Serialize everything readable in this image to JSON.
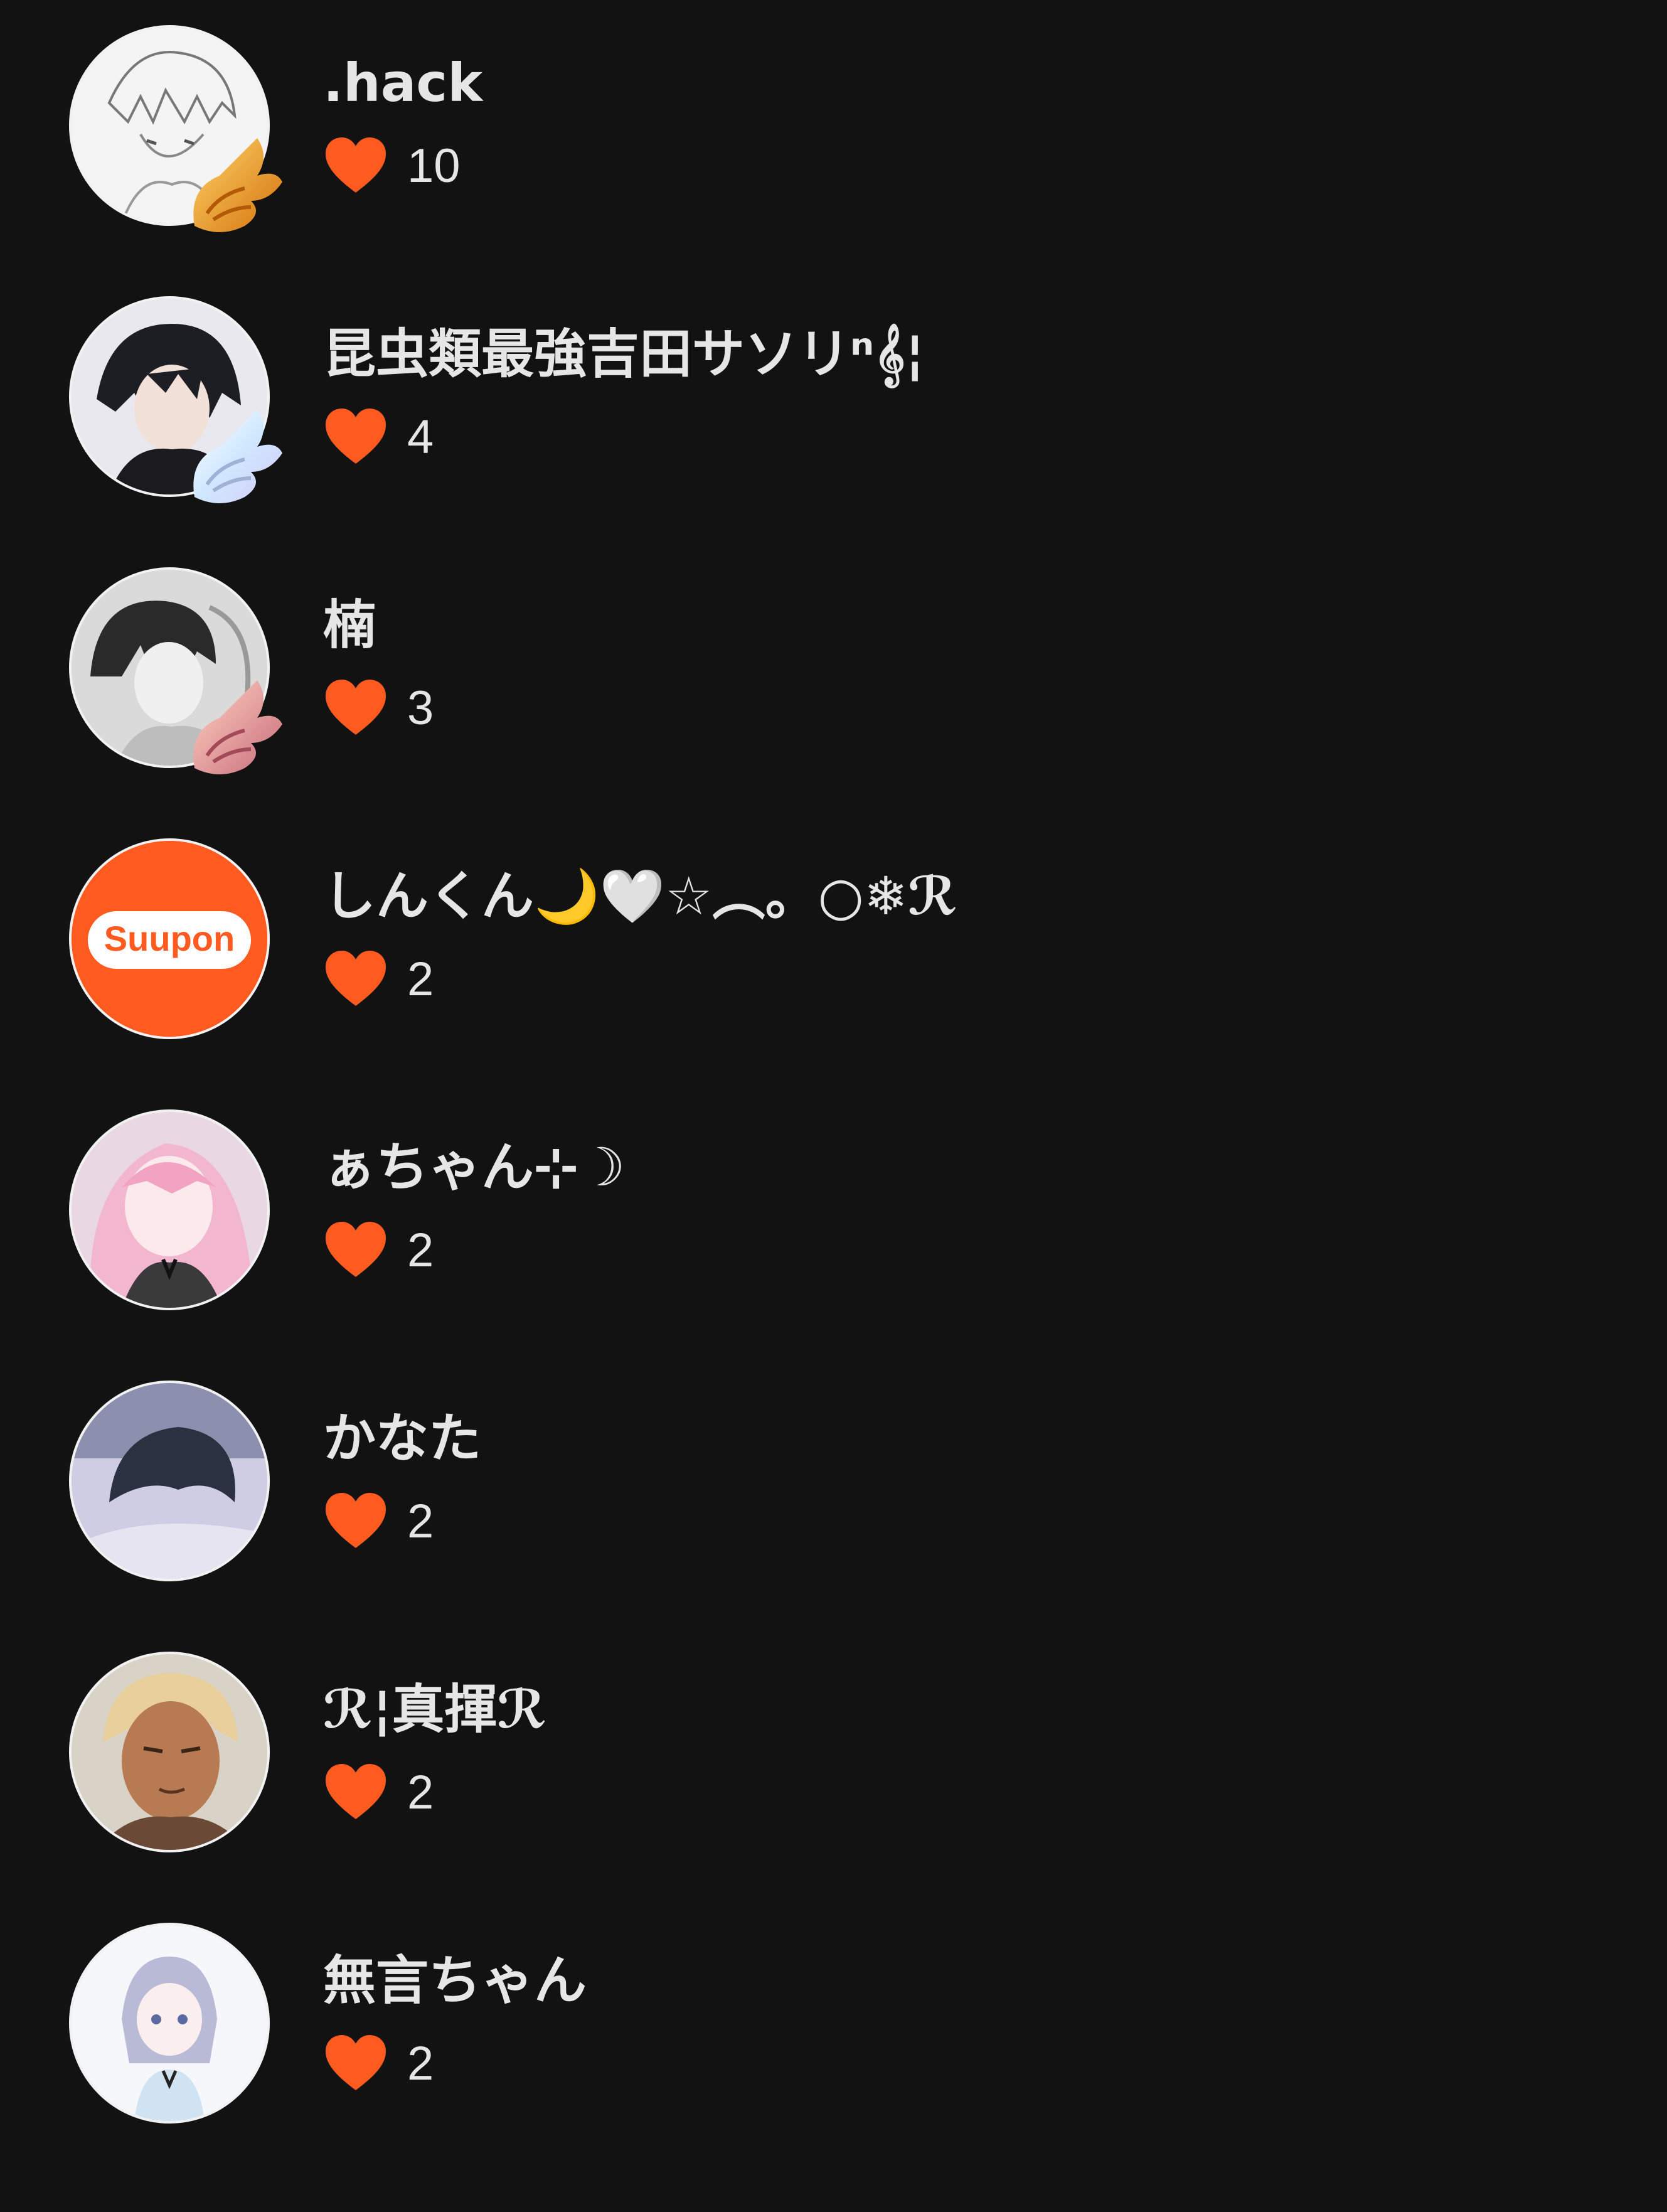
{
  "users": [
    {
      "name": ".hack",
      "likes": "10",
      "avatar": "sketch-avatar",
      "badge": "gold-wing-icon"
    },
    {
      "name": "昆虫類最強吉田サソリⁿ𝄞¦",
      "likes": "4",
      "avatar": "dark-hair-avatar",
      "badge": "pearl-wing-icon"
    },
    {
      "name": "楠",
      "likes": "3",
      "avatar": "monochrome-avatar",
      "badge": "pink-wing-icon"
    },
    {
      "name": "しんくん🌙🤍☆︵。○❄ℛ",
      "likes": "2",
      "avatar": "suupon-logo",
      "logo_text": "Suupon"
    },
    {
      "name": "ぁちゃん⊹☽",
      "likes": "2",
      "avatar": "pink-hair-avatar"
    },
    {
      "name": "かなた",
      "likes": "2",
      "avatar": "sleeping-avatar"
    },
    {
      "name": "ℛ¦真揮ℛ",
      "likes": "2",
      "avatar": "blond-avatar"
    },
    {
      "name": "無言ちゃん",
      "likes": "2",
      "avatar": "chibi-avatar"
    }
  ],
  "colors": {
    "background": "#121212",
    "heart": "#ff5a1f",
    "text": "#e6e6e6",
    "suupon": "#ff5a1f"
  }
}
